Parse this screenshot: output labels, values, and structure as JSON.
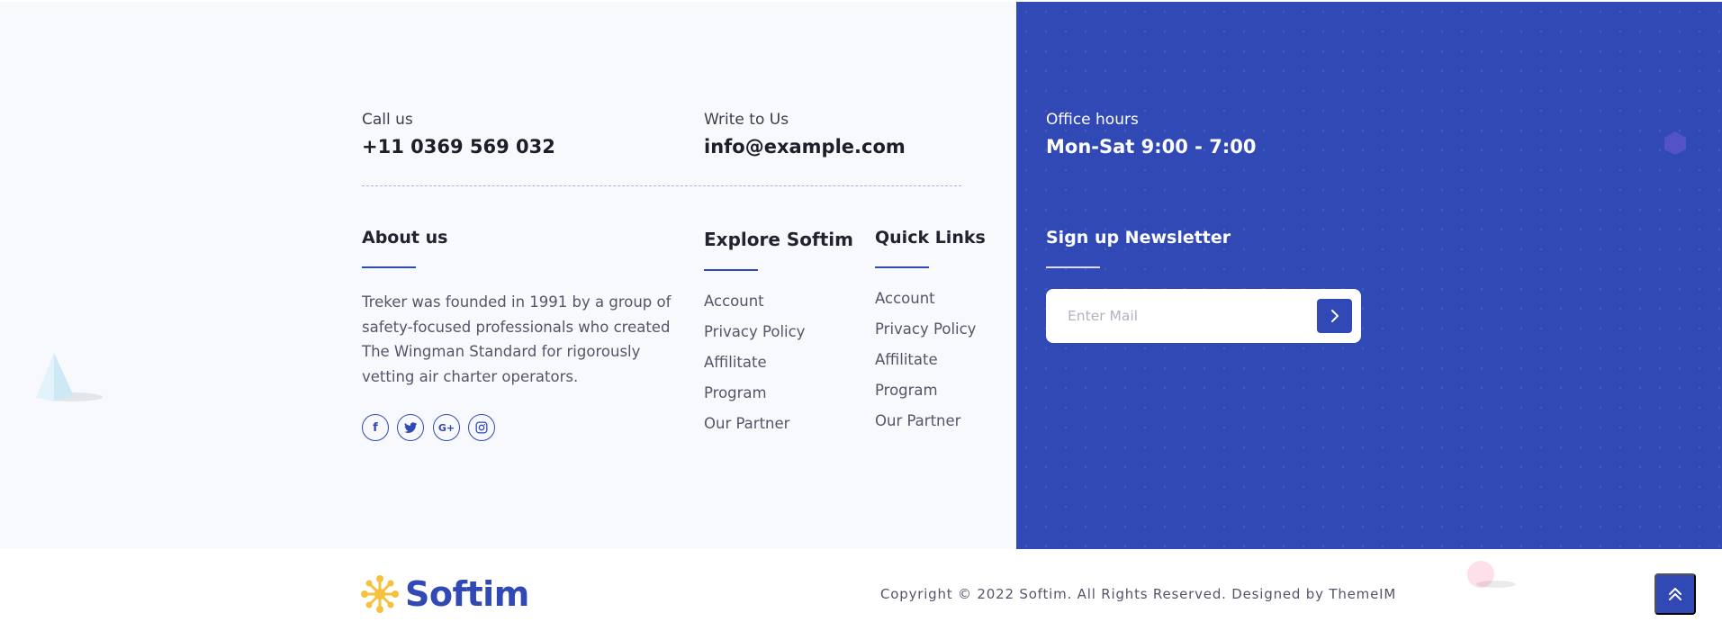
{
  "contact": {
    "call": {
      "label": "Call us",
      "value": "+11 0369 569 032"
    },
    "write": {
      "label": "Write to Us",
      "value": "info@example.com"
    },
    "hours": {
      "label": "Office hours",
      "value": "Mon-Sat 9:00 - 7:00"
    }
  },
  "about": {
    "heading": "About us",
    "text": "Treker was founded in 1991 by a group of safety-focused professionals who created The Wingman Standard for rigorously vetting air charter operators.",
    "social_icons": [
      "facebook-icon",
      "twitter-icon",
      "google-plus-icon",
      "instagram-icon"
    ],
    "social_glyphs": {
      "facebook": "f",
      "google_plus": "G+"
    }
  },
  "explore": {
    "heading": "Explore Softim",
    "links": [
      "Account",
      "Privacy Policy",
      "Affilitate",
      "Program",
      "Our Partner"
    ]
  },
  "quick_links": {
    "heading": "Quick Links",
    "links": [
      "Account",
      "Privacy Policy",
      "Affilitate",
      "Program",
      "Our Partner"
    ]
  },
  "newsletter": {
    "heading": "Sign up Newsletter",
    "placeholder": "Enter Mail",
    "submit_icon": "chevron-right-icon"
  },
  "footer": {
    "logo_text": "Softim",
    "copyright": "Copyright © 2022 Softim. All Rights Reserved. Designed by ThemeIM",
    "scroll_top_icon": "double-chevron-up-icon"
  },
  "colors": {
    "brand_blue": "#3149b5",
    "light_bg": "#f8f9fd",
    "logo_accent": "#f6c23e"
  }
}
